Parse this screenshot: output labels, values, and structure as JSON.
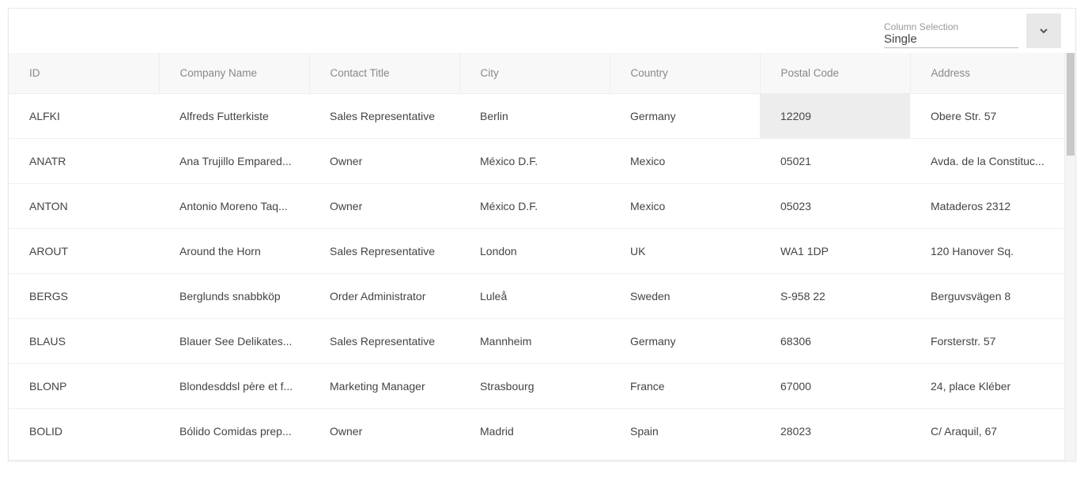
{
  "toolbar": {
    "select_label": "Column Selection",
    "select_value": "Single"
  },
  "columns": [
    "ID",
    "Company Name",
    "Contact Title",
    "City",
    "Country",
    "Postal Code",
    "Address"
  ],
  "selected_cell": {
    "row": 0,
    "col": 5
  },
  "rows": [
    {
      "id": "ALFKI",
      "company": "Alfreds Futterkiste",
      "title": "Sales Representative",
      "city": "Berlin",
      "country": "Germany",
      "postal": "12209",
      "address": "Obere Str. 57"
    },
    {
      "id": "ANATR",
      "company": "Ana Trujillo Empared...",
      "title": "Owner",
      "city": "México D.F.",
      "country": "Mexico",
      "postal": "05021",
      "address": "Avda. de la Constituc..."
    },
    {
      "id": "ANTON",
      "company": "Antonio Moreno Taq...",
      "title": "Owner",
      "city": "México D.F.",
      "country": "Mexico",
      "postal": "05023",
      "address": "Mataderos 2312"
    },
    {
      "id": "AROUT",
      "company": "Around the Horn",
      "title": "Sales Representative",
      "city": "London",
      "country": "UK",
      "postal": "WA1 1DP",
      "address": "120 Hanover Sq."
    },
    {
      "id": "BERGS",
      "company": "Berglunds snabbköp",
      "title": "Order Administrator",
      "city": "Luleå",
      "country": "Sweden",
      "postal": "S-958 22",
      "address": "Berguvsvägen 8"
    },
    {
      "id": "BLAUS",
      "company": "Blauer See Delikates...",
      "title": "Sales Representative",
      "city": "Mannheim",
      "country": "Germany",
      "postal": "68306",
      "address": "Forsterstr. 57"
    },
    {
      "id": "BLONP",
      "company": "Blondesddsl père et f...",
      "title": "Marketing Manager",
      "city": "Strasbourg",
      "country": "France",
      "postal": "67000",
      "address": "24, place Kléber"
    },
    {
      "id": "BOLID",
      "company": "Bólido Comidas prep...",
      "title": "Owner",
      "city": "Madrid",
      "country": "Spain",
      "postal": "28023",
      "address": "C/ Araquil, 67"
    }
  ]
}
